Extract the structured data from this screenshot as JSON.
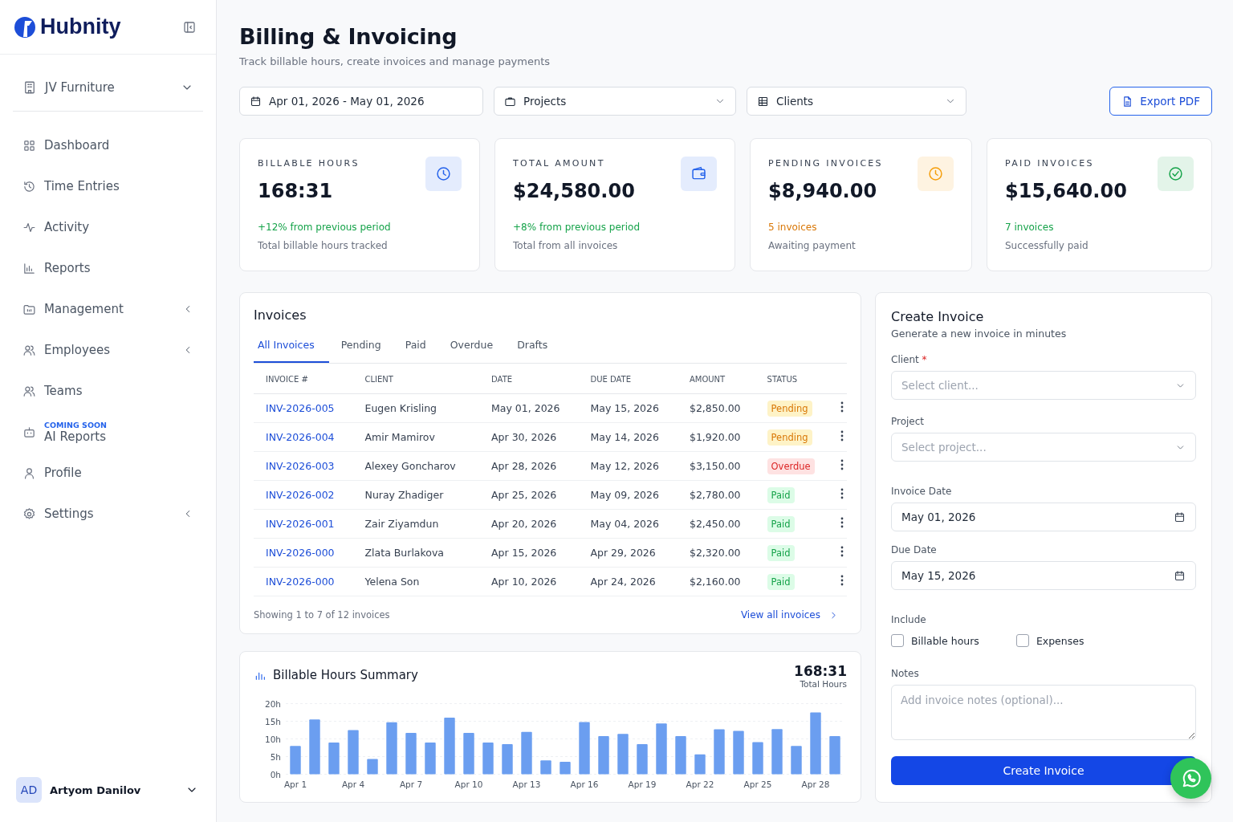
{
  "sidebar": {
    "brand": "Hubnity",
    "org": "JV Furniture",
    "items": [
      {
        "label": "Dashboard",
        "expandable": false
      },
      {
        "label": "Time Entries",
        "expandable": false
      },
      {
        "label": "Activity",
        "expandable": false
      },
      {
        "label": "Reports",
        "expandable": false
      },
      {
        "label": "Management",
        "expandable": true
      },
      {
        "label": "Employees",
        "expandable": true
      },
      {
        "label": "Teams",
        "expandable": false
      },
      {
        "label": "AI Reports",
        "expandable": false,
        "tag": "COMING SOON"
      },
      {
        "label": "Profile",
        "expandable": false
      },
      {
        "label": "Settings",
        "expandable": true
      }
    ],
    "user": {
      "initials": "AD",
      "name": "Artyom Danilov"
    }
  },
  "header": {
    "title": "Billing & Invoicing",
    "subtitle": "Track billable hours, create invoices and manage payments"
  },
  "filters": {
    "date_range": "Apr 01, 2026 - May 01, 2026",
    "projects": "Projects",
    "clients": "Clients",
    "export": "Export PDF"
  },
  "stats": [
    {
      "kind": "hours",
      "label": "BILLABLE HOURS",
      "value": "168:31",
      "note": "+12% from previous period",
      "detail": "Total billable hours tracked",
      "color": "#2563eb"
    },
    {
      "kind": "amount",
      "label": "TOTAL AMOUNT",
      "value": "$24,580.00",
      "note": "+8% from previous period",
      "detail": "Total from all invoices",
      "color": "#2563eb"
    },
    {
      "kind": "pending",
      "label": "PENDING INVOICES",
      "value": "$8,940.00",
      "note": "5 invoices",
      "detail": "Awaiting payment",
      "color": "#f59e0b"
    },
    {
      "kind": "paid",
      "label": "PAID INVOICES",
      "value": "$15,640.00",
      "note": "7 invoices",
      "detail": "Successfully paid",
      "color": "#16a34a"
    }
  ],
  "invoices": {
    "title": "Invoices",
    "tabs": [
      {
        "label": "All Invoices",
        "selected": true
      },
      {
        "label": "Pending",
        "selected": false
      },
      {
        "label": "Paid",
        "selected": false
      },
      {
        "label": "Overdue",
        "selected": false
      },
      {
        "label": "Drafts",
        "selected": false
      }
    ],
    "columns": [
      "INVOICE #",
      "CLIENT",
      "DATE",
      "DUE DATE",
      "AMOUNT",
      "STATUS"
    ],
    "rows": [
      {
        "invoice": "INV-2026-005",
        "client": "Eugen Krisling",
        "date": "May 01, 2026",
        "due": "May 15, 2026",
        "amount": "$2,850.00",
        "status": "Pending",
        "kind": "pending"
      },
      {
        "invoice": "INV-2026-004",
        "client": "Amir Mamirov",
        "date": "Apr 30, 2026",
        "due": "May 14, 2026",
        "amount": "$1,920.00",
        "status": "Pending",
        "kind": "pending"
      },
      {
        "invoice": "INV-2026-003",
        "client": "Alexey Goncharov",
        "date": "Apr 28, 2026",
        "due": "May 12, 2026",
        "amount": "$3,150.00",
        "status": "Overdue",
        "kind": "overdue"
      },
      {
        "invoice": "INV-2026-002",
        "client": "Nuray Zhadiger",
        "date": "Apr 25, 2026",
        "due": "May 09, 2026",
        "amount": "$2,780.00",
        "status": "Paid",
        "kind": "paid"
      },
      {
        "invoice": "INV-2026-001",
        "client": "Zair Ziyamdun",
        "date": "Apr 20, 2026",
        "due": "May 04, 2026",
        "amount": "$2,450.00",
        "status": "Paid",
        "kind": "paid"
      },
      {
        "invoice": "INV-2026-000",
        "client": "Zlata Burlakova",
        "date": "Apr 15, 2026",
        "due": "Apr 29, 2026",
        "amount": "$2,320.00",
        "status": "Paid",
        "kind": "paid"
      },
      {
        "invoice": "INV-2026-000",
        "client": "Yelena Son",
        "date": "Apr 10, 2026",
        "due": "Apr 24, 2026",
        "amount": "$2,160.00",
        "status": "Paid",
        "kind": "paid"
      }
    ],
    "footer": "Showing 1 to 7 of 12 invoices",
    "view_all": "View all invoices"
  },
  "summary": {
    "title": "Billable Hours Summary",
    "total": "168:31",
    "total_label": "Total Hours",
    "chart_data": {
      "type": "bar",
      "categories": [
        "Apr 1",
        null,
        null,
        "Apr 4",
        null,
        null,
        "Apr 7",
        null,
        null,
        "Apr 10",
        null,
        null,
        "Apr 13",
        null,
        null,
        "Apr 16",
        null,
        null,
        "Apr 19",
        null,
        null,
        "Apr 22",
        null,
        null,
        "Apr 25",
        null,
        null,
        "Apr 28",
        null
      ],
      "grid": true,
      "series": [
        {
          "color": "#6b9ef0",
          "values": [
            8,
            15.5,
            9,
            12.5,
            4.3,
            14.7,
            11.7,
            9,
            16,
            11.7,
            9,
            8.5,
            12,
            3.9,
            3.5,
            14.8,
            10.8,
            11.4,
            8.5,
            14.4,
            10.8,
            5.6,
            12.7,
            12.3,
            9.1,
            12.8,
            8,
            17.5,
            10.8
          ]
        }
      ],
      "ylim": [
        0,
        20
      ],
      "yticks": [
        {
          "value": 0,
          "label": "0h"
        },
        {
          "value": 5,
          "label": "5h"
        },
        {
          "value": 10,
          "label": "10h"
        },
        {
          "value": 15,
          "label": "15h"
        },
        {
          "value": 20,
          "label": "20h"
        }
      ]
    }
  },
  "create": {
    "title": "Create Invoice",
    "subtitle": "Generate a new invoice in minutes",
    "client_label": "Client",
    "required_mark": "*",
    "client": {
      "placeholder": "Select client..."
    },
    "project_label": "Project",
    "project": {
      "placeholder": "Select project..."
    },
    "invoice_date_label": "Invoice Date",
    "invoice_date": "May 01, 2026",
    "due_date_label": "Due Date",
    "due_date": "May 15, 2026",
    "include_label": "Include",
    "options": [
      {
        "label": "Billable hours",
        "checked": false
      },
      {
        "label": "Expenses",
        "checked": false
      }
    ],
    "notes_label": "Notes",
    "notes": {
      "placeholder": "Add invoice notes (optional)..."
    },
    "button": "Create Invoice"
  }
}
